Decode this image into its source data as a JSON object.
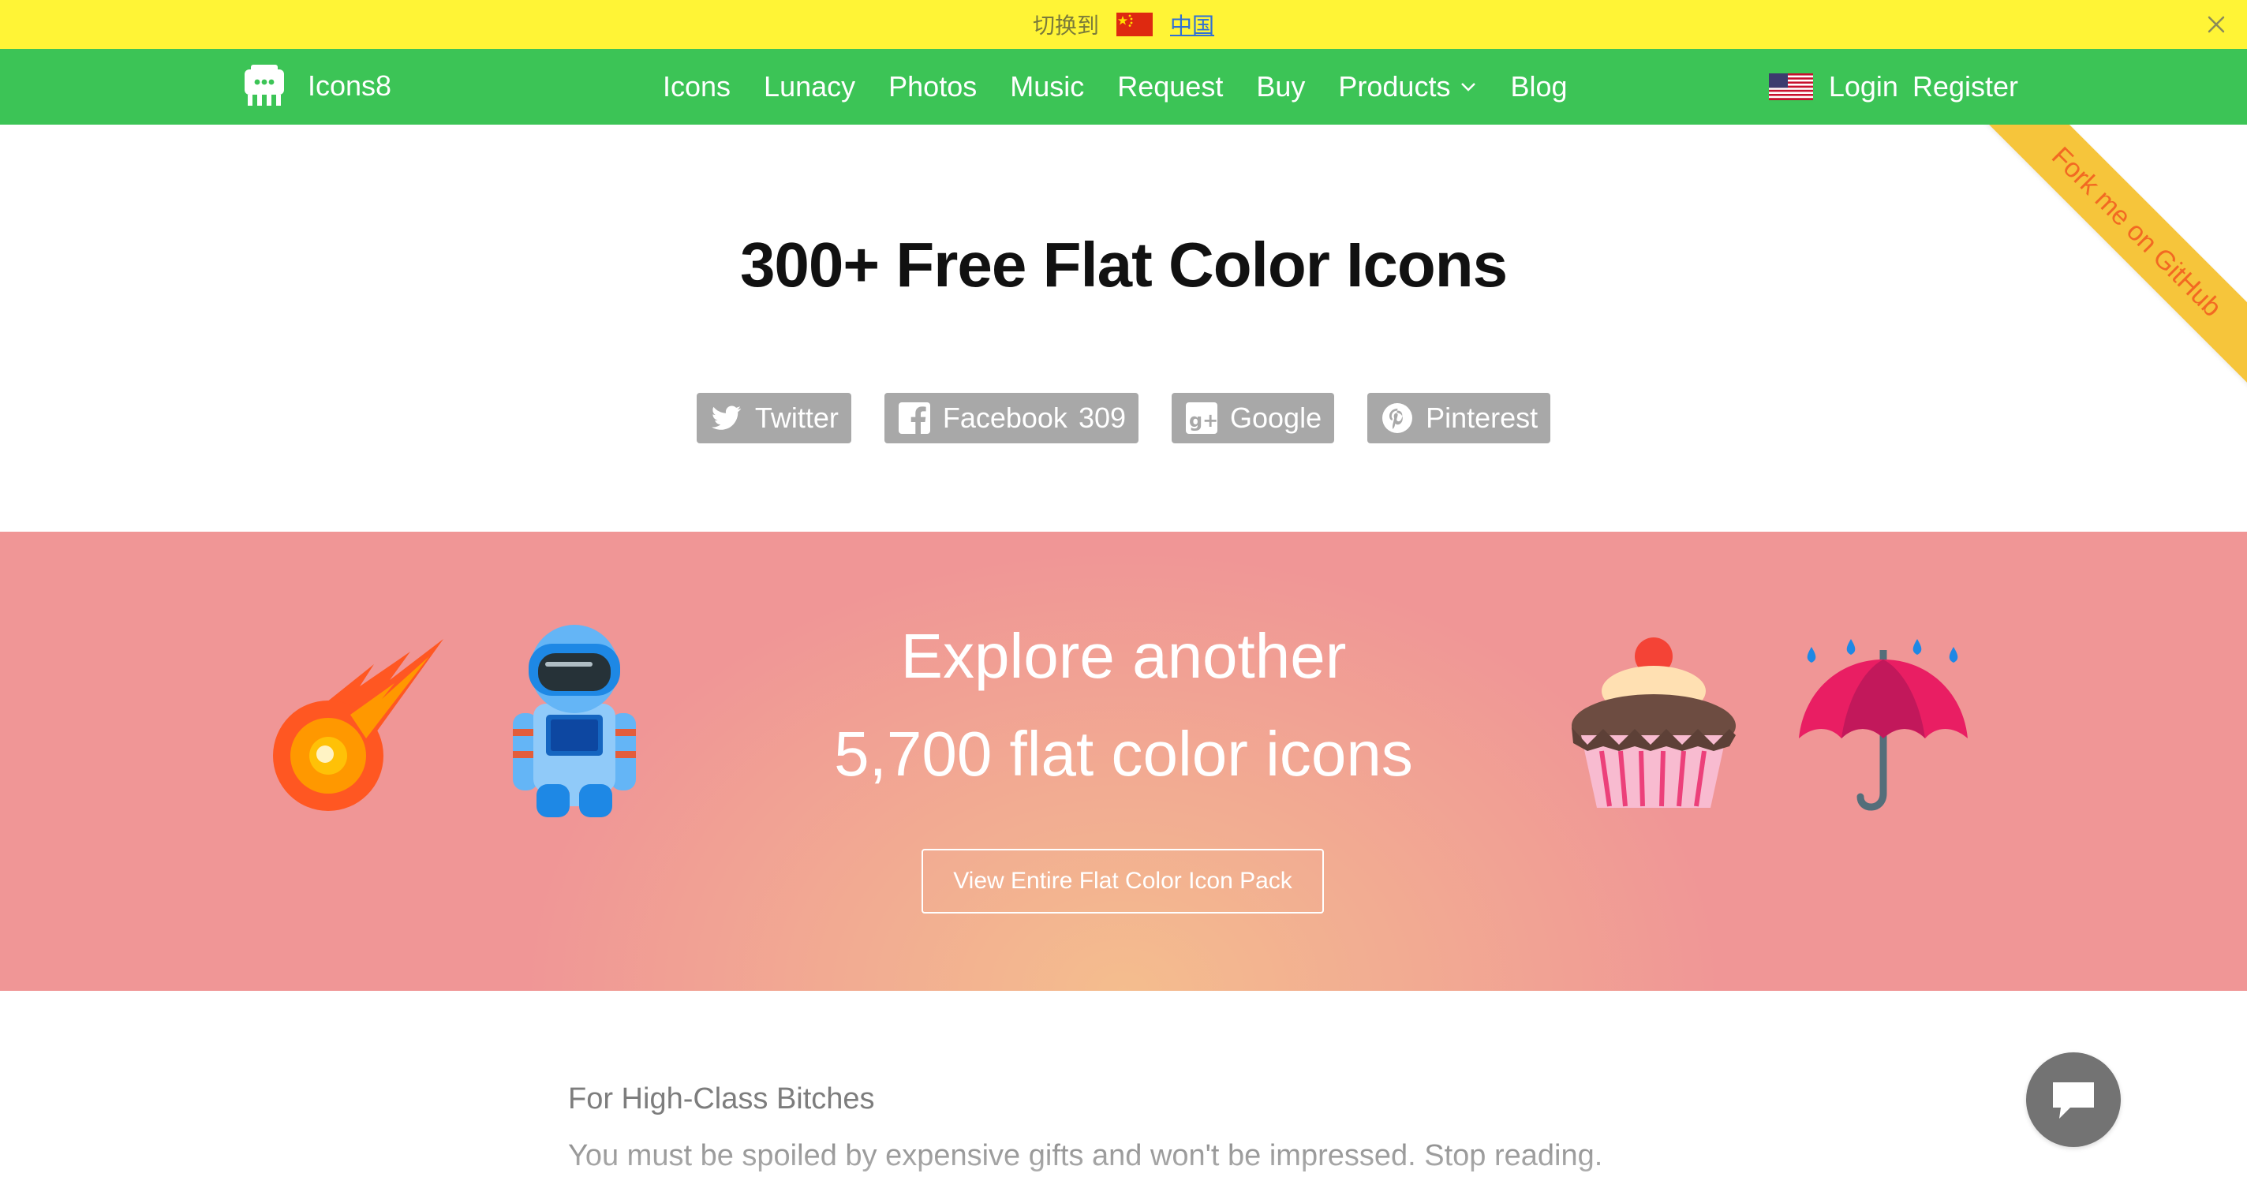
{
  "lang_bar": {
    "text": "切换到",
    "link": "中国",
    "close_icon": "close-icon"
  },
  "nav": {
    "logo_text": "Icons8",
    "links": [
      "Icons",
      "Lunacy",
      "Photos",
      "Music",
      "Request",
      "Buy",
      "Products",
      "Blog"
    ],
    "login": "Login",
    "register": "Register"
  },
  "ribbon": {
    "label": "Fork me on GitHub"
  },
  "hero": {
    "title": "300+ Free Flat Color Icons"
  },
  "share": {
    "twitter": "Twitter",
    "facebook": "Facebook",
    "facebook_count": "309",
    "google": "Google",
    "pinterest": "Pinterest"
  },
  "promo": {
    "line1": "Explore another",
    "line2": "5,700 flat color icons",
    "button": "View Entire Flat Color Icon Pack",
    "icons": [
      "comet-icon",
      "astronaut-icon",
      "cupcake-icon",
      "umbrella-icon"
    ]
  },
  "article": {
    "heading": "For High-Class Bitches",
    "paragraph": "You must be spoiled by expensive gifts and won't be impressed. Stop reading."
  },
  "colors": {
    "lang_bar_bg": "#fff436",
    "nav_bg": "#3cc456",
    "share_bg": "#a8a8a8",
    "promo_edge": "#f09696",
    "promo_center": "#f4bd8e",
    "ribbon_bg": "#f6c53b",
    "ribbon_text": "#f26922"
  }
}
